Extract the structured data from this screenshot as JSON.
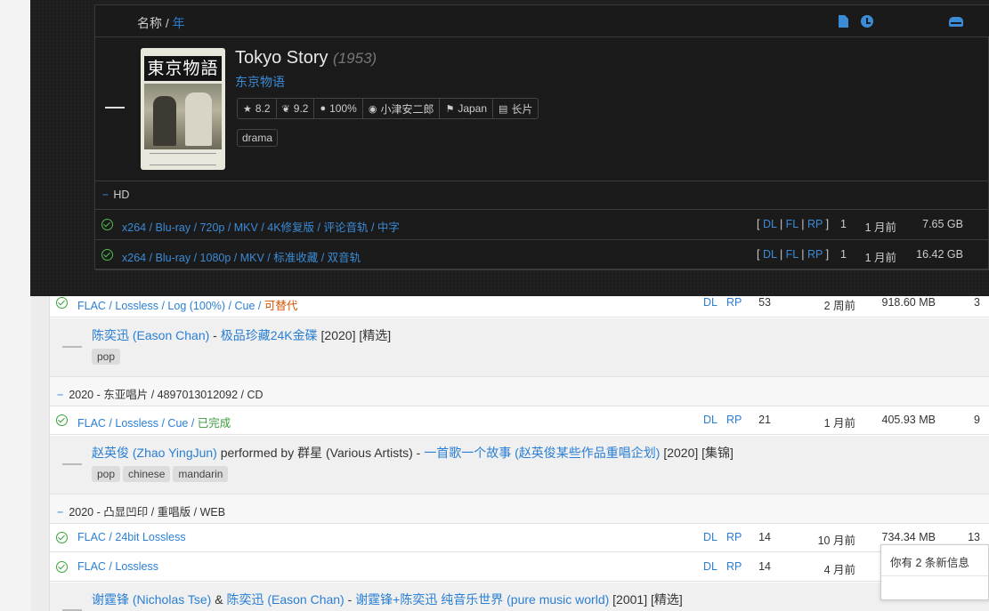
{
  "header": {
    "name_label": "名称",
    "sep": " / ",
    "year_label": "年",
    "icons": [
      "file-icon",
      "clock-icon",
      "drive-icon"
    ]
  },
  "movie": {
    "title": "Tokyo Story",
    "year": "(1953)",
    "alt_title": "东京物语",
    "poster_title": "東京物語",
    "badges": {
      "imdb": "8.2",
      "douban": "9.2",
      "rt": "100%",
      "director": "小津安二郎",
      "country": "Japan",
      "length": "长片"
    },
    "genre": "drama",
    "edition": "HD",
    "files": [
      {
        "desc": "x264 / Blu-ray / 720p / MKV / 4K修复版 / 评论音轨 / 中字",
        "dl": "DL",
        "fl": "FL",
        "rp": "RP",
        "count": "1",
        "age": "1 月前",
        "size": "7.65 GB"
      },
      {
        "desc": "x264 / Blu-ray / 1080p / MKV / 标准收藏 / 双音轨",
        "dl": "DL",
        "fl": "FL",
        "rp": "RP",
        "count": "1",
        "age": "1 月前",
        "size": "16.42 GB"
      }
    ]
  },
  "list": {
    "rows": [
      {
        "desc": "FLAC / Lossless / Log (100%) / Cue / ",
        "status": "可替代",
        "dl": "DL",
        "rp": "RP",
        "count": "53",
        "age": "2 周前",
        "size": "918.60 MB",
        "seed": "3"
      },
      {
        "artist": "陈奕迅 (Eason Chan)",
        "joiner": " - ",
        "album": "极品珍藏24K金碟",
        "meta": " [2020] [精选]",
        "tags": [
          "pop"
        ]
      },
      {
        "edition": "2020 - 东亚唱片 / 4897013012092 / CD"
      },
      {
        "desc": "FLAC / Lossless / Cue / ",
        "status": "已完成",
        "dl": "DL",
        "rp": "RP",
        "count": "21",
        "age": "1 月前",
        "size": "405.93 MB",
        "seed": "9"
      },
      {
        "artist": "赵英俊 (Zhao YingJun)",
        "performed": " performed by ",
        "artist2": "群星 (Various Artists)",
        "joiner": " - ",
        "album": "一首歌一个故事 (赵英俊某些作品重唱企划)",
        "meta": " [2020] [集锦]",
        "tags": [
          "pop",
          "chinese",
          "mandarin"
        ]
      },
      {
        "edition": "2020 - 凸显凹印 / 重唱版 / WEB"
      },
      {
        "desc": "FLAC / 24bit Lossless",
        "dl": "DL",
        "rp": "RP",
        "count": "14",
        "age": "10 月前",
        "size": "734.34 MB",
        "seed": "13"
      },
      {
        "desc": "FLAC / Lossless",
        "dl": "DL",
        "rp": "RP",
        "count": "14",
        "age": "4 月前",
        "size": "",
        "seed": ""
      },
      {
        "artist": "谢霆锋 (Nicholas Tse)",
        "amp": " & ",
        "artist2": "陈奕迅 (Eason Chan)",
        "joiner": " - ",
        "album": "谢霆锋+陈奕迅 纯音乐世界 (pure music world)",
        "meta": " [2001] [精选]"
      }
    ]
  },
  "notification": {
    "text": "你有 2 条新信息"
  },
  "colors": {
    "link": "#2a7fd4",
    "dark_bg": "#1e1e1e",
    "ok": "#3a9a3a",
    "warn": "#d35400"
  }
}
